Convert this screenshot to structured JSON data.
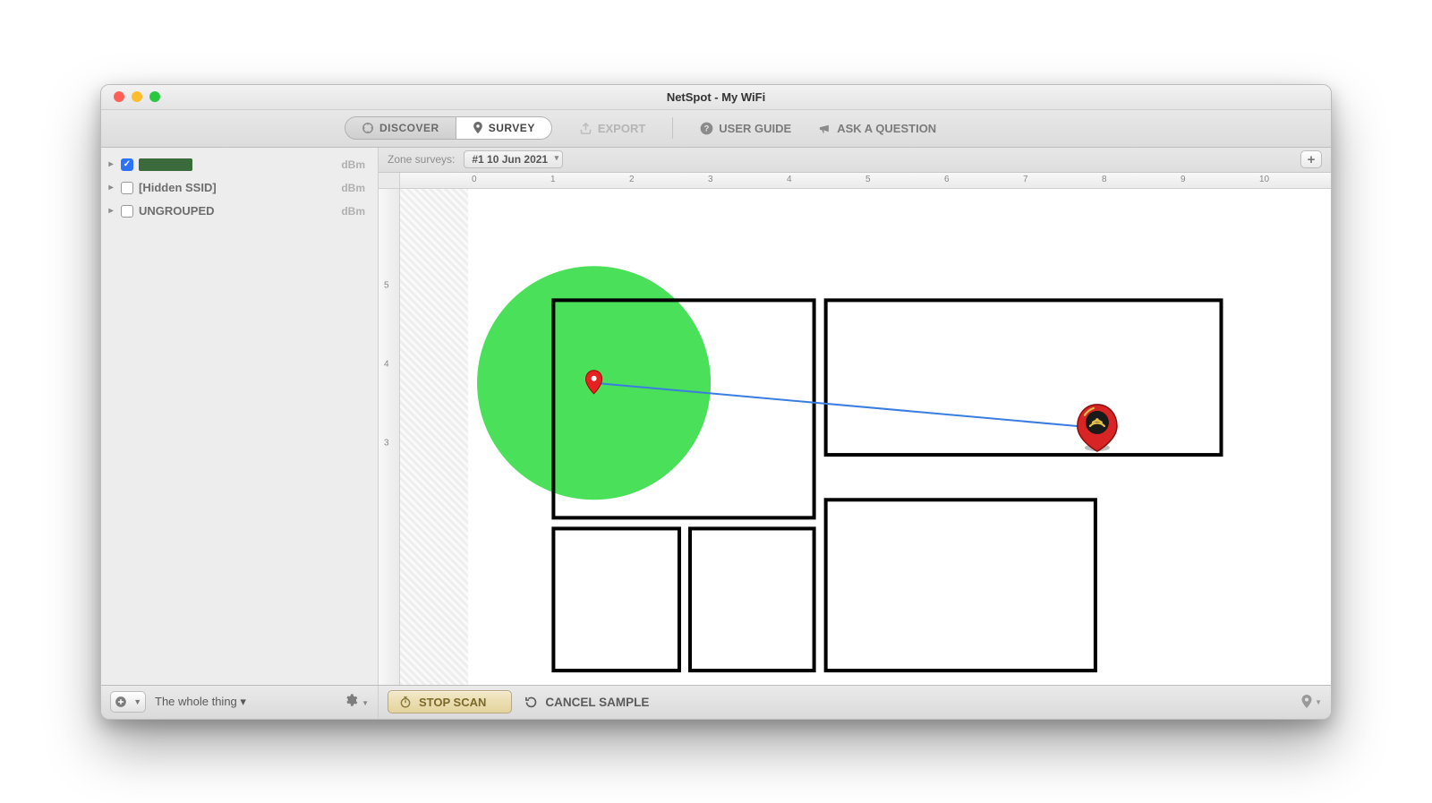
{
  "window": {
    "title": "NetSpot - My WiFi"
  },
  "toolbar": {
    "discover": "DISCOVER",
    "survey": "SURVEY",
    "export": "EXPORT",
    "user_guide": "USER GUIDE",
    "ask": "ASK A QUESTION"
  },
  "sidebar": {
    "items": [
      {
        "checked": true,
        "label_hidden": true,
        "label": "",
        "unit": "dBm"
      },
      {
        "checked": false,
        "label_hidden": false,
        "label": "[Hidden SSID]",
        "unit": "dBm"
      },
      {
        "checked": false,
        "label_hidden": false,
        "label": "UNGROUPED",
        "unit": "dBm"
      }
    ],
    "bottom_dropdown": "The whole thing ▾"
  },
  "zonebar": {
    "label": "Zone surveys:",
    "selected": "#1 10 Jun 2021"
  },
  "ruler_h": [
    "0",
    "1",
    "2",
    "3",
    "4",
    "5",
    "6",
    "7",
    "8",
    "9",
    "10"
  ],
  "ruler_v": [
    "5",
    "4",
    "3"
  ],
  "bottombar": {
    "stop_scan": "STOP SCAN",
    "cancel_sample": "CANCEL SAMPLE"
  }
}
